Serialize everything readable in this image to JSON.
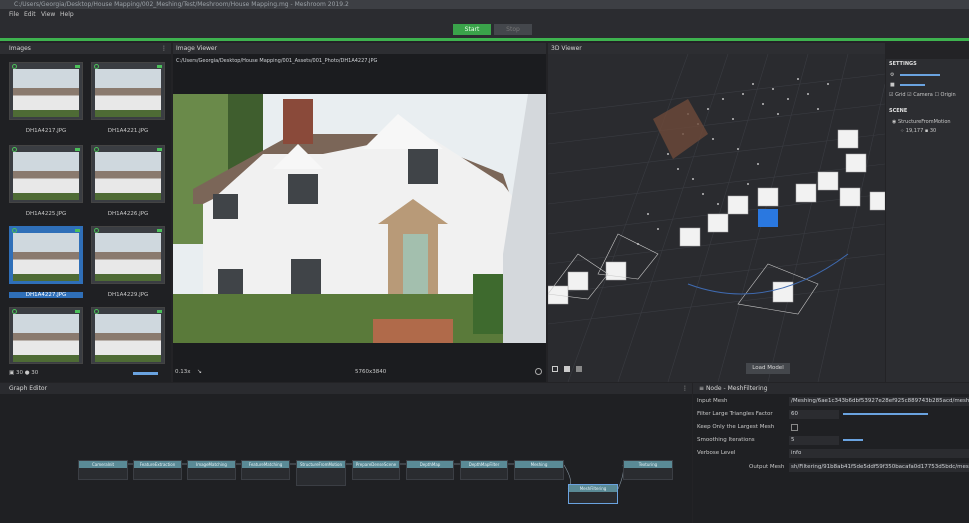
{
  "window": {
    "title": "C:/Users/Georgia/Desktop/House Mapping/002_Meshing/Test/Meshroom/House Mapping.mg - Meshroom 2019.2"
  },
  "menu": [
    "File",
    "Edit",
    "View",
    "Help"
  ],
  "toolbar": {
    "start_label": "Start",
    "stop_label": "Stop"
  },
  "images_panel": {
    "title": "Images",
    "thumbnails": [
      {
        "label": "DH1A4217.JPG"
      },
      {
        "label": "DH1A4221.JPG"
      },
      {
        "label": "DH1A4225.JPG"
      },
      {
        "label": "DH1A4226.JPG"
      },
      {
        "label": "DH1A4227.JPG"
      },
      {
        "label": "DH1A4229.JPG"
      },
      {
        "label": ""
      },
      {
        "label": ""
      }
    ],
    "footer_count_a": "30",
    "footer_count_b": "30"
  },
  "image_viewer": {
    "title": "Image Viewer",
    "path": "C:/Users/Georgia/Desktop/House Mapping/001_Assets/001_Photo/DH1A4227.JPG",
    "zoom": "0.13x",
    "resolution": "5760x3840"
  },
  "viewer_3d": {
    "title": "3D Viewer",
    "load_model_label": "Load Model"
  },
  "settings_panel": {
    "title": "SETTINGS",
    "grid_label": "Grid",
    "camera_label": "Camera",
    "origin_label": "Origin",
    "scene_title": "SCENE",
    "scene_item": "StructureFromMotion",
    "scene_points": "19,177",
    "scene_cams": "30"
  },
  "graph_editor": {
    "title": "Graph Editor",
    "nodes": [
      "CameraInit",
      "FeatureExtraction",
      "ImageMatching",
      "FeatureMatching",
      "StructureFromMotion",
      "PrepareDenseScene",
      "DepthMap",
      "DepthMapFilter",
      "Meshing",
      "MeshFiltering",
      "Texturing"
    ]
  },
  "attributes": {
    "title": "Node - MeshFiltering",
    "rows": [
      {
        "key": "Input Mesh",
        "value": "/Meshing/6ae1c343b6dbf53927e28ef925c889743b285acd/mesh"
      },
      {
        "key": "Filter Large Triangles Factor",
        "value": "60"
      },
      {
        "key": "Keep Only the Largest Mesh",
        "value": ""
      },
      {
        "key": "Smoothing Iterations",
        "value": "5"
      },
      {
        "key": "Verbose Level",
        "value": "info"
      },
      {
        "key": "Output Mesh",
        "value": "sh/Filtering/91b8ab41f5de5ddf59f350bacafa0d17753d5bdc/mesh"
      }
    ]
  },
  "colors": {
    "accent_green": "#3eb34f",
    "selection_blue": "#2f6fb8",
    "node_header": "#5a8a96"
  }
}
